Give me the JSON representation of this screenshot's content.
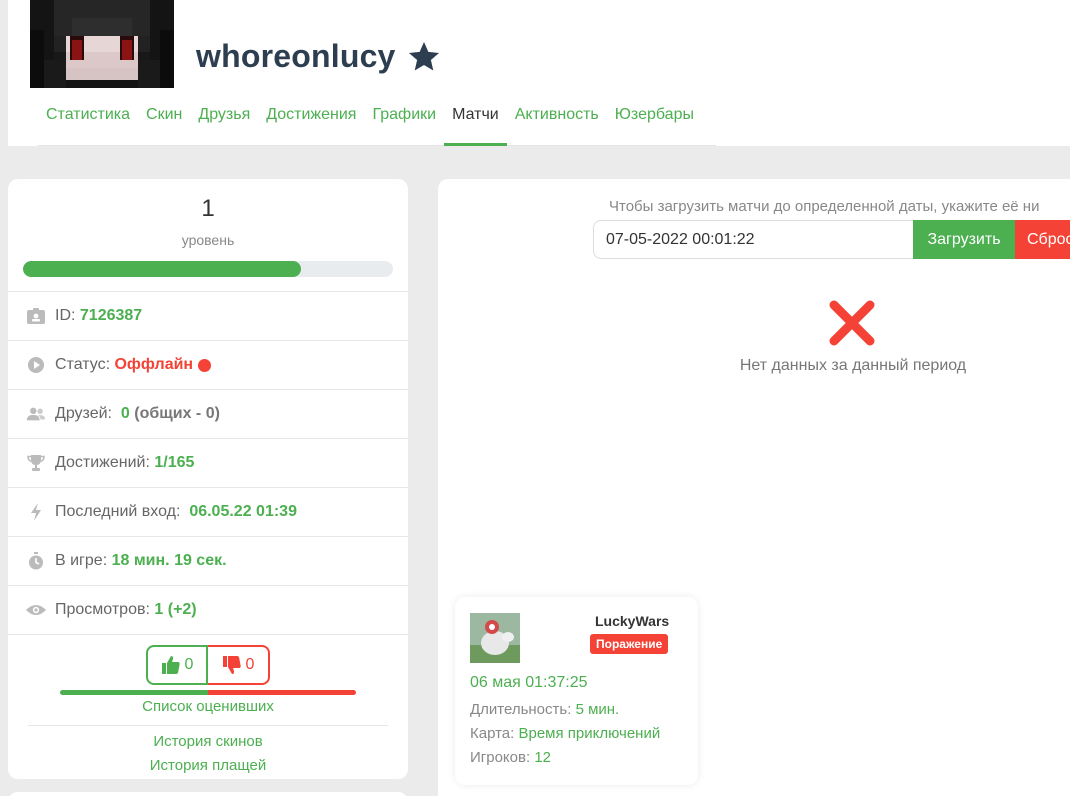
{
  "profile": {
    "username": "whoreonlucy",
    "star_icon": "star-icon"
  },
  "nav": {
    "items": [
      {
        "label": "Статистика"
      },
      {
        "label": "Скин"
      },
      {
        "label": "Друзья"
      },
      {
        "label": "Достижения"
      },
      {
        "label": "Графики"
      },
      {
        "label": "Матчи",
        "active": true
      },
      {
        "label": "Активность"
      },
      {
        "label": "Юзербары"
      }
    ]
  },
  "level": {
    "value": "1",
    "label": "уровень",
    "progress_fraction": 0.75
  },
  "stats": {
    "id_label": "ID:",
    "id_value": "7126387",
    "status_label": "Статус:",
    "status_value": "Оффлайн",
    "friends_label": "Друзей:",
    "friends_value": "0",
    "friends_common": "(общих - 0)",
    "achievements_label": "Достижений:",
    "achievements_value": "1/165",
    "last_login_label": "Последний вход:",
    "last_login_value": "06.05.22 01:39",
    "ingame_label": "В игре:",
    "ingame_value": "18 мин. 19 сек.",
    "views_label": "Просмотров:",
    "views_value": "1",
    "views_delta": "(+2)"
  },
  "votes": {
    "likes": "0",
    "dislikes": "0",
    "raters_link": "Список оценивших",
    "skins_history": "История скинов",
    "capes_history": "История плащей"
  },
  "matches": {
    "hint": "Чтобы загрузить матчи до определенной даты, укажите её ни",
    "date_value": "07-05-2022 00:01:22",
    "load_button": "Загрузить",
    "reset_button": "Сброс",
    "no_data": "Нет данных за данный период",
    "card": {
      "mode": "LuckyWars",
      "result": "Поражение",
      "date": "06 мая 01:37:25",
      "duration_label": "Длительность:",
      "duration_value": "5 мин.",
      "map_label": "Карта:",
      "map_value": "Время приключений",
      "players_label": "Игроков:",
      "players_value": "12"
    }
  },
  "colors": {
    "accent_green": "#4caf50",
    "accent_red": "#f44336",
    "title_dark": "#2c3e50"
  }
}
